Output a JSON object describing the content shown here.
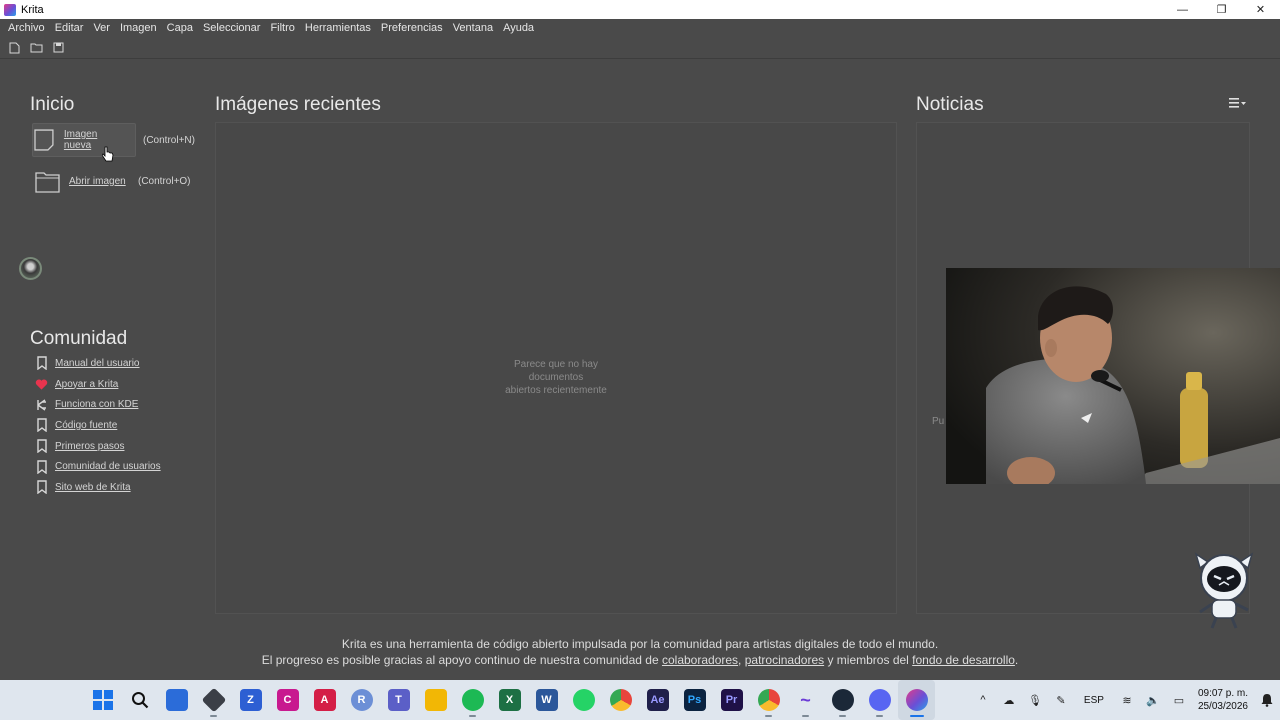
{
  "window": {
    "title": "Krita",
    "minimize_glyph": "—",
    "restore_glyph": "❐",
    "close_glyph": "✕"
  },
  "menu": [
    "Archivo",
    "Editar",
    "Ver",
    "Imagen",
    "Capa",
    "Seleccionar",
    "Filtro",
    "Herramientas",
    "Preferencias",
    "Ventana",
    "Ayuda"
  ],
  "toolbar": {
    "icons": [
      "new-document-icon",
      "open-folder-icon",
      "save-icon"
    ]
  },
  "start": {
    "title": "Inicio",
    "new_image": {
      "label": "Imagen nueva",
      "shortcut": "(Control+N)"
    },
    "open_image": {
      "label": "Abrir imagen",
      "shortcut": "(Control+O)"
    }
  },
  "recent": {
    "title": "Imágenes recientes",
    "empty_line1": "Parece que no hay documentos",
    "empty_line2": "abiertos recientemente"
  },
  "news": {
    "title": "Noticias",
    "partial_text": "Pu"
  },
  "community": {
    "title": "Comunidad",
    "items": [
      {
        "label": "Manual del usuario",
        "icon": "bookmark-icon"
      },
      {
        "label": "Apoyar a Krita",
        "icon": "heart-icon"
      },
      {
        "label": "Funciona con KDE",
        "icon": "kde-icon"
      },
      {
        "label": "Código fuente",
        "icon": "bookmark-icon"
      },
      {
        "label": "Primeros pasos",
        "icon": "bookmark-icon"
      },
      {
        "label": "Comunidad de usuarios",
        "icon": "bookmark-icon"
      },
      {
        "label": "Sito web de Krita",
        "icon": "bookmark-icon"
      }
    ]
  },
  "footer": {
    "line1": "Krita es una herramienta de código abierto impulsada por la comunidad para artistas digitales de todo el mundo.",
    "line2_prefix": "El progreso es posible gracias al apoyo continuo de nuestra comunidad de",
    "link_contributors": "colaboradores",
    "sep1": ",",
    "link_sponsors": "patrocinadores",
    "mid": "y miembros del",
    "link_fund": "fondo de desarrollo",
    "end": "."
  },
  "taskbar": {
    "apps": [
      {
        "name": "start-button",
        "glyph": "",
        "color": "#1a73e8"
      },
      {
        "name": "search-button",
        "glyph": "",
        "color": "transparent"
      },
      {
        "name": "microsoft-store",
        "glyph": "",
        "color": "#2b6cd9"
      },
      {
        "name": "app-3d",
        "glyph": "",
        "color": "#3b3f47"
      },
      {
        "name": "app-z",
        "glyph": "Z",
        "color": "#2d5fd3"
      },
      {
        "name": "app-c",
        "glyph": "C",
        "color": "#c8198f"
      },
      {
        "name": "app-a",
        "glyph": "A",
        "color": "#d41e46"
      },
      {
        "name": "app-r",
        "glyph": "R",
        "color": "#6c8fd6"
      },
      {
        "name": "teams",
        "glyph": "T",
        "color": "#5b5fc7"
      },
      {
        "name": "file-explorer",
        "glyph": "",
        "color": "#f2b705"
      },
      {
        "name": "spotify",
        "glyph": "",
        "color": "#1db954"
      },
      {
        "name": "excel",
        "glyph": "X",
        "color": "#1d7044"
      },
      {
        "name": "word",
        "glyph": "W",
        "color": "#2b579a"
      },
      {
        "name": "whatsapp",
        "glyph": "",
        "color": "#25d366"
      },
      {
        "name": "chrome",
        "glyph": "",
        "color": "#e8453c"
      },
      {
        "name": "after-effects",
        "glyph": "Ae",
        "color": "#1f1f4a"
      },
      {
        "name": "photoshop",
        "glyph": "Ps",
        "color": "#0b2340"
      },
      {
        "name": "premiere",
        "glyph": "Pr",
        "color": "#1f1147"
      },
      {
        "name": "chrome-profile",
        "glyph": "",
        "color": "#e8453c"
      },
      {
        "name": "app-wave",
        "glyph": "~",
        "color": "#6a3ad6"
      },
      {
        "name": "steam",
        "glyph": "",
        "color": "#1b2838"
      },
      {
        "name": "discord",
        "glyph": "",
        "color": "#5865f2"
      },
      {
        "name": "krita",
        "glyph": "",
        "color": "#e23b8a"
      }
    ],
    "language": "ESP",
    "time": "09:07 p. m.",
    "date": "25/03/2026"
  }
}
